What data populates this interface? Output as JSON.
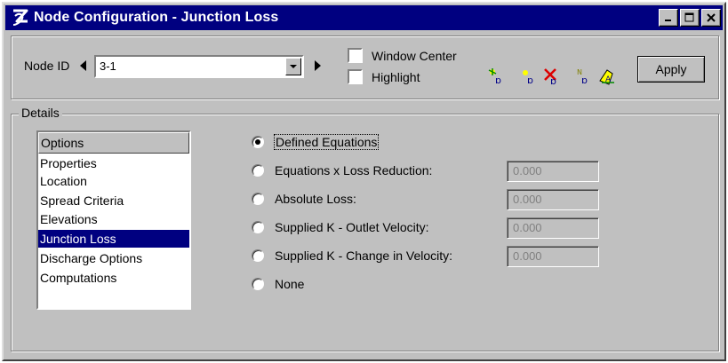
{
  "window": {
    "title": "Node Configuration - Junction Loss"
  },
  "toolbar": {
    "node_id_label": "Node ID",
    "node_id_value": "3-1",
    "window_center_label": "Window Center",
    "highlight_label": "Highlight",
    "apply_label": "Apply"
  },
  "details": {
    "group_label": "Details",
    "options_header": "Options",
    "options": [
      "Properties",
      "Location",
      "Spread Criteria",
      "Elevations",
      "Junction Loss",
      "Discharge Options",
      "Computations"
    ],
    "selected_option": "Junction Loss",
    "radios": [
      {
        "label": "Defined Equations",
        "checked": true,
        "value": null
      },
      {
        "label": "Equations x Loss Reduction:",
        "checked": false,
        "value": "0.000"
      },
      {
        "label": "Absolute Loss:",
        "checked": false,
        "value": "0.000"
      },
      {
        "label": "Supplied K - Outlet Velocity:",
        "checked": false,
        "value": "0.000"
      },
      {
        "label": "Supplied K - Change in Velocity:",
        "checked": false,
        "value": "0.000"
      },
      {
        "label": "None",
        "checked": false,
        "value": null
      }
    ]
  },
  "colors": {
    "titlebar": "#000080",
    "face": "#c0c0c0",
    "selection": "#000080"
  }
}
